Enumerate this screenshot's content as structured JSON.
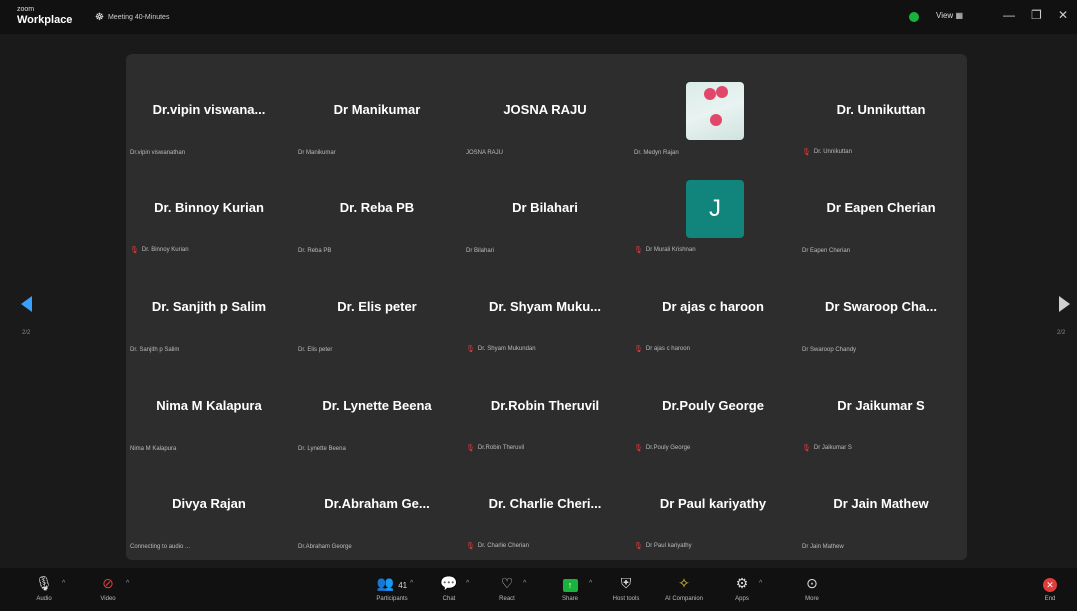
{
  "titlebar": {
    "brand_small": "zoom",
    "brand": "Workplace",
    "meeting_title": "Meeting 40-Minutes",
    "view_label": "View"
  },
  "pagination": {
    "left": "2/2",
    "right": "2/2"
  },
  "participants": [
    {
      "name": "Dr.vipin  viswana...",
      "label": "Dr.vipin viswanathan",
      "muted": false
    },
    {
      "name": "Dr Manikumar",
      "label": "Dr Manikumar",
      "muted": false
    },
    {
      "name": "JOSNA RAJU",
      "label": "JOSNA RAJU",
      "muted": false
    },
    {
      "name": "",
      "label": "Dr. Medyn Rajan",
      "muted": false,
      "avatar": "flower-photo"
    },
    {
      "name": "Dr. Unnikuttan",
      "label": "Dr. Unnikuttan",
      "muted": true
    },
    {
      "name": "Dr. Binnoy Kurian",
      "label": "Dr. Binnoy Kurian",
      "muted": true
    },
    {
      "name": "Dr. Reba PB",
      "label": "Dr. Reba PB",
      "muted": false
    },
    {
      "name": "Dr Bilahari",
      "label": "Dr Bilahari",
      "muted": false
    },
    {
      "name": "",
      "label": "Dr Murali Krishnan",
      "muted": true,
      "avatar_letter": "J"
    },
    {
      "name": "Dr Eapen Cherian",
      "label": "Dr Eapen Cherian",
      "muted": false
    },
    {
      "name": "Dr. Sanjith p Salim",
      "label": "Dr. Sanjith p Salim",
      "muted": false
    },
    {
      "name": "Dr. Elis peter",
      "label": "Dr. Elis peter",
      "muted": false
    },
    {
      "name": "Dr. Shyam Muku...",
      "label": "Dr. Shyam Mukundan",
      "muted": true
    },
    {
      "name": "Dr ajas c haroon",
      "label": "Dr ajas c haroon",
      "muted": true
    },
    {
      "name": "Dr Swaroop Cha...",
      "label": "Dr Swaroop Chandy",
      "muted": false
    },
    {
      "name": "Nima M Kalapura",
      "label": "Nima M Kalapura",
      "muted": false
    },
    {
      "name": "Dr. Lynette Beena",
      "label": "Dr. Lynette Beena",
      "muted": false
    },
    {
      "name": "Dr.Robin Theruvil",
      "label": "Dr.Robin Theruvil",
      "muted": true
    },
    {
      "name": "Dr.Pouly George",
      "label": "Dr.Pouly George",
      "muted": true
    },
    {
      "name": "Dr Jaikumar S",
      "label": "Dr Jaikumar S",
      "muted": true
    },
    {
      "name": "Divya Rajan",
      "label": "Connecting to audio ...",
      "muted": false
    },
    {
      "name": "Dr.Abraham  Ge...",
      "label": "Dr.Abraham George",
      "muted": false
    },
    {
      "name": "Dr. Charlie Cheri...",
      "label": "Dr. Charlie Cherian",
      "muted": true
    },
    {
      "name": "Dr Paul kariyathy",
      "label": "Dr Paul kariyathy",
      "muted": true
    },
    {
      "name": "Dr Jain Mathew",
      "label": "Dr Jain Mathew",
      "muted": false
    }
  ],
  "toolbar": {
    "audio": "Audio",
    "video": "Video",
    "participants": "Participants",
    "participants_count": "41",
    "chat": "Chat",
    "react": "React",
    "share": "Share",
    "host_tools": "Host tools",
    "ai_companion": "AI Companion",
    "apps": "Apps",
    "more": "More",
    "end": "End"
  },
  "colors": {
    "accent_blue": "#3aa0ff",
    "share_green": "#19b33b",
    "end_red": "#e23b3b",
    "avatar_teal": "#11857b"
  }
}
